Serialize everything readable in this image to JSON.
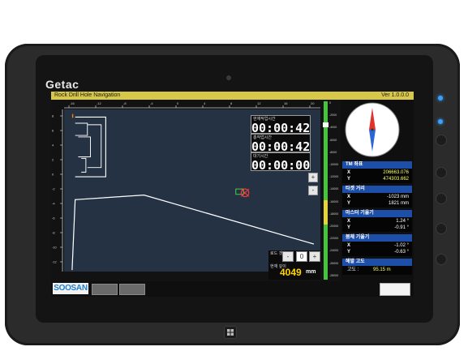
{
  "device": {
    "brand": "Getac",
    "icons": [
      "home-icon",
      "led-icon",
      "hardware-button-icon"
    ]
  },
  "app": {
    "title": "Rock Drill Hole Navigation",
    "version": "Ver 1.0.0.0"
  },
  "timers": {
    "t1_label": "현재작업시간",
    "t1_value": "00:00:42",
    "t2_label": "총작업시간",
    "t2_value": "00:00:42",
    "t3_label": "대기시간",
    "t3_value": "00:00:00"
  },
  "zoom": {
    "in_label": "+",
    "out_label": "-"
  },
  "rod": {
    "count_label": "로드 갯수",
    "minus_label": "-",
    "count_value": "0",
    "plus_label": "+",
    "depth_label": "현재 깊이",
    "depth_value": "4049",
    "depth_unit": "mm"
  },
  "top_ruler": [
    "-16",
    "-12",
    "-8",
    "-4",
    "0",
    "4",
    "8",
    "12",
    "16",
    "20"
  ],
  "left_ruler": [
    "8",
    "6",
    "4",
    "2",
    "0",
    "-2",
    "-4",
    "-6",
    "-8",
    "-10",
    "-12",
    "-14"
  ],
  "depth_scale": [
    "0",
    "-2000",
    "-4000",
    "-6000",
    "-8000",
    "-10000",
    "-12000",
    "-14000",
    "-16000",
    "-18000",
    "-20000",
    "-22000",
    "-24000",
    "-26000",
    "-28000"
  ],
  "tm": {
    "title": "TM 좌표",
    "x_label": "X",
    "x_value": "206663.076",
    "y_label": "Y",
    "y_value": "474303.662"
  },
  "target_distance": {
    "title": "타겟 거리",
    "x_label": "X",
    "x_value": "-1023 mm",
    "y_label": "Y",
    "y_value": "1821 mm"
  },
  "mast_tilt": {
    "title": "마스터 기울기",
    "x_label": "X",
    "x_value": "1.24 °",
    "y_label": "Y",
    "y_value": "-0.91 °"
  },
  "boom_tilt": {
    "title": "붐체 기울기",
    "x_label": "X",
    "x_value": "-1.02 °",
    "y_label": "Y",
    "y_value": "-0.63 °"
  },
  "altitude": {
    "title": "해발 고도",
    "label": "고도 :",
    "value": "95.15 m"
  },
  "bottom": {
    "logo": "SOOSAN",
    "tab1": "",
    "tab2": ""
  },
  "colors": {
    "titlebar": "#d8c84a",
    "section_header": "#1e4fa8",
    "timer_text": "#ffffff",
    "depth_value": "#ffd400",
    "highlight_value": "#ffff66",
    "map_bg": "#243244"
  }
}
